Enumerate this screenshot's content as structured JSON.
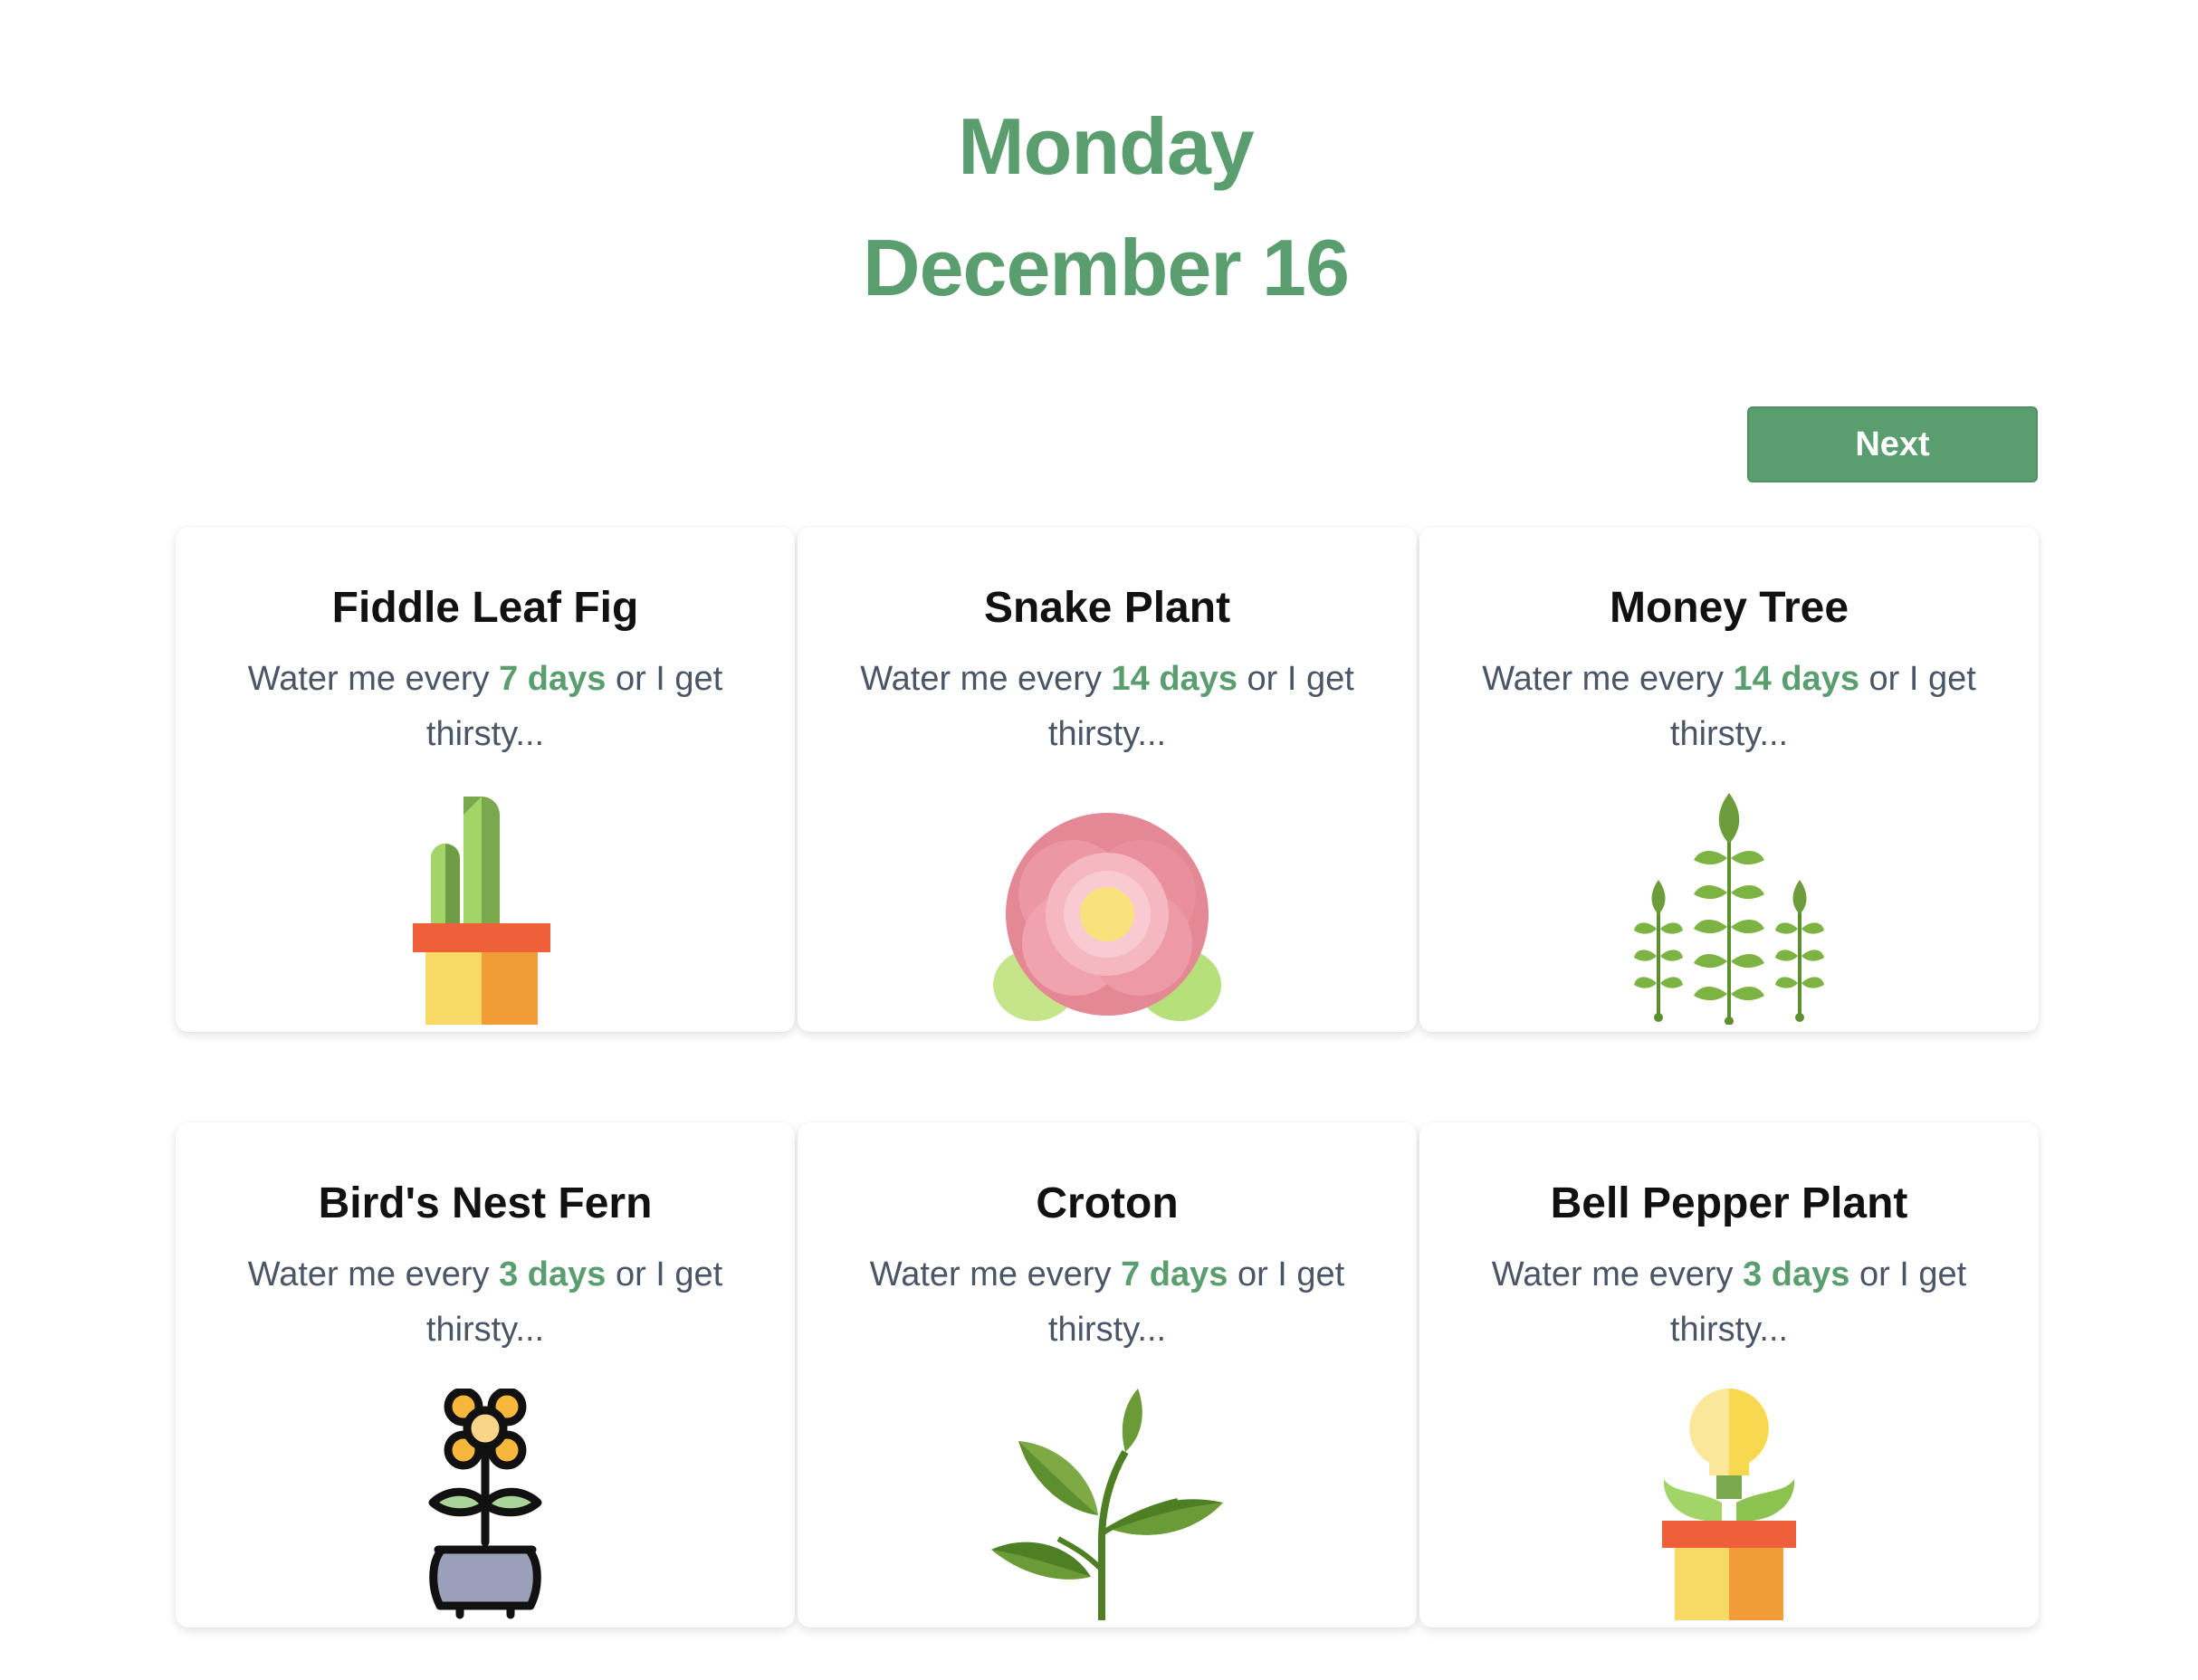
{
  "header": {
    "day": "Monday",
    "date": "December 16"
  },
  "controls": {
    "next_label": "Next"
  },
  "colors": {
    "accent": "#5a9e6f",
    "text_muted": "#4a5566"
  },
  "plants": [
    {
      "name": "Fiddle Leaf Fig",
      "prefix": "Water me every ",
      "days": "7 days",
      "suffix": " or I get thirsty...",
      "icon": "cactus-pot-icon"
    },
    {
      "name": "Snake Plant",
      "prefix": "Water me every ",
      "days": "14 days",
      "suffix": " or I get thirsty...",
      "icon": "pink-flower-icon"
    },
    {
      "name": "Money Tree",
      "prefix": "Water me every ",
      "days": "14 days",
      "suffix": " or I get thirsty...",
      "icon": "fern-sprigs-icon"
    },
    {
      "name": "Bird's Nest Fern",
      "prefix": "Water me every ",
      "days": "3 days",
      "suffix": " or I get thirsty...",
      "icon": "potted-flower-icon"
    },
    {
      "name": "Croton",
      "prefix": "Water me every ",
      "days": "7 days",
      "suffix": " or I get thirsty...",
      "icon": "leafy-sprout-icon"
    },
    {
      "name": "Bell Pepper Plant",
      "prefix": "Water me every ",
      "days": "3 days",
      "suffix": " or I get thirsty...",
      "icon": "bulb-plant-pot-icon"
    }
  ]
}
